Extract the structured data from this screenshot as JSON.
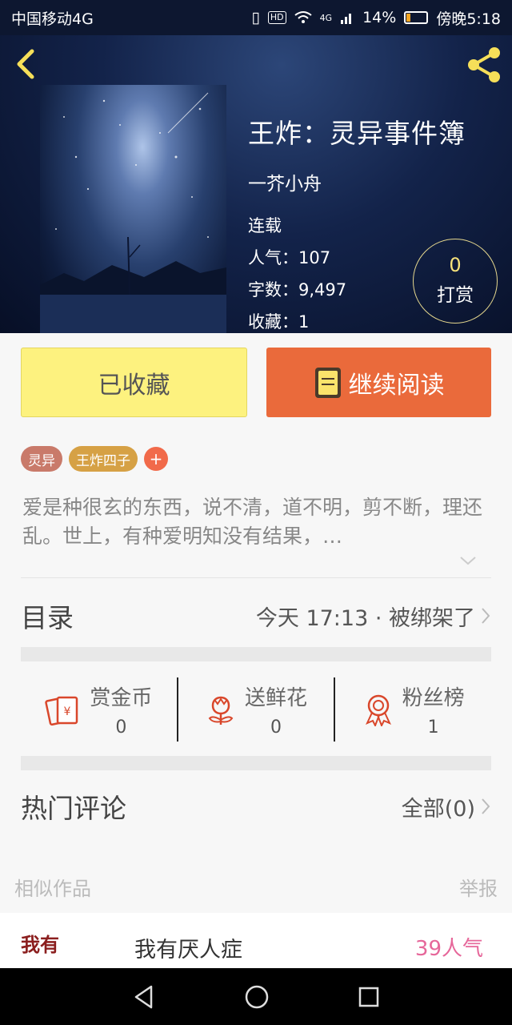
{
  "status_bar": {
    "carrier": "中国移动4G",
    "hd": "HD",
    "net": "4G",
    "battery": "14%",
    "time": "傍晚5:18"
  },
  "book": {
    "title": "王炸：灵异事件簿",
    "author": "一芥小舟",
    "status": "连载",
    "popularity": "人气：107",
    "words": "字数：9,497",
    "favorites": "收藏：1",
    "reward_count": "0",
    "reward_label": "打赏"
  },
  "actions": {
    "favorited_label": "已收藏",
    "continue_label": "继续阅读"
  },
  "tags": [
    "灵异",
    "王炸四子"
  ],
  "tag_add": "+",
  "description": "爱是种很玄的东西，说不清，道不明，剪不断，理还乱。世上，有种爱明知没有结果，…",
  "catalog": {
    "label": "目录",
    "latest": "今天 17:13 · 被绑架了"
  },
  "interactions": [
    {
      "label": "赏金币",
      "count": "0",
      "icon": "red-envelope-icon"
    },
    {
      "label": "送鲜花",
      "count": "0",
      "icon": "flower-icon"
    },
    {
      "label": "粉丝榜",
      "count": "1",
      "icon": "ribbon-badge-icon"
    }
  ],
  "comments": {
    "label": "热门评论",
    "all": "全部(0)"
  },
  "similar": {
    "label": "相似作品",
    "report": "举报",
    "items": [
      {
        "thumb_text": "我有",
        "title": "我有厌人症",
        "popularity": "39人气"
      }
    ]
  },
  "colors": {
    "accent_yellow": "#fdf27f",
    "accent_orange": "#ea6a3b",
    "icon_red": "#d9472b",
    "header_dark": "#0d1730"
  }
}
